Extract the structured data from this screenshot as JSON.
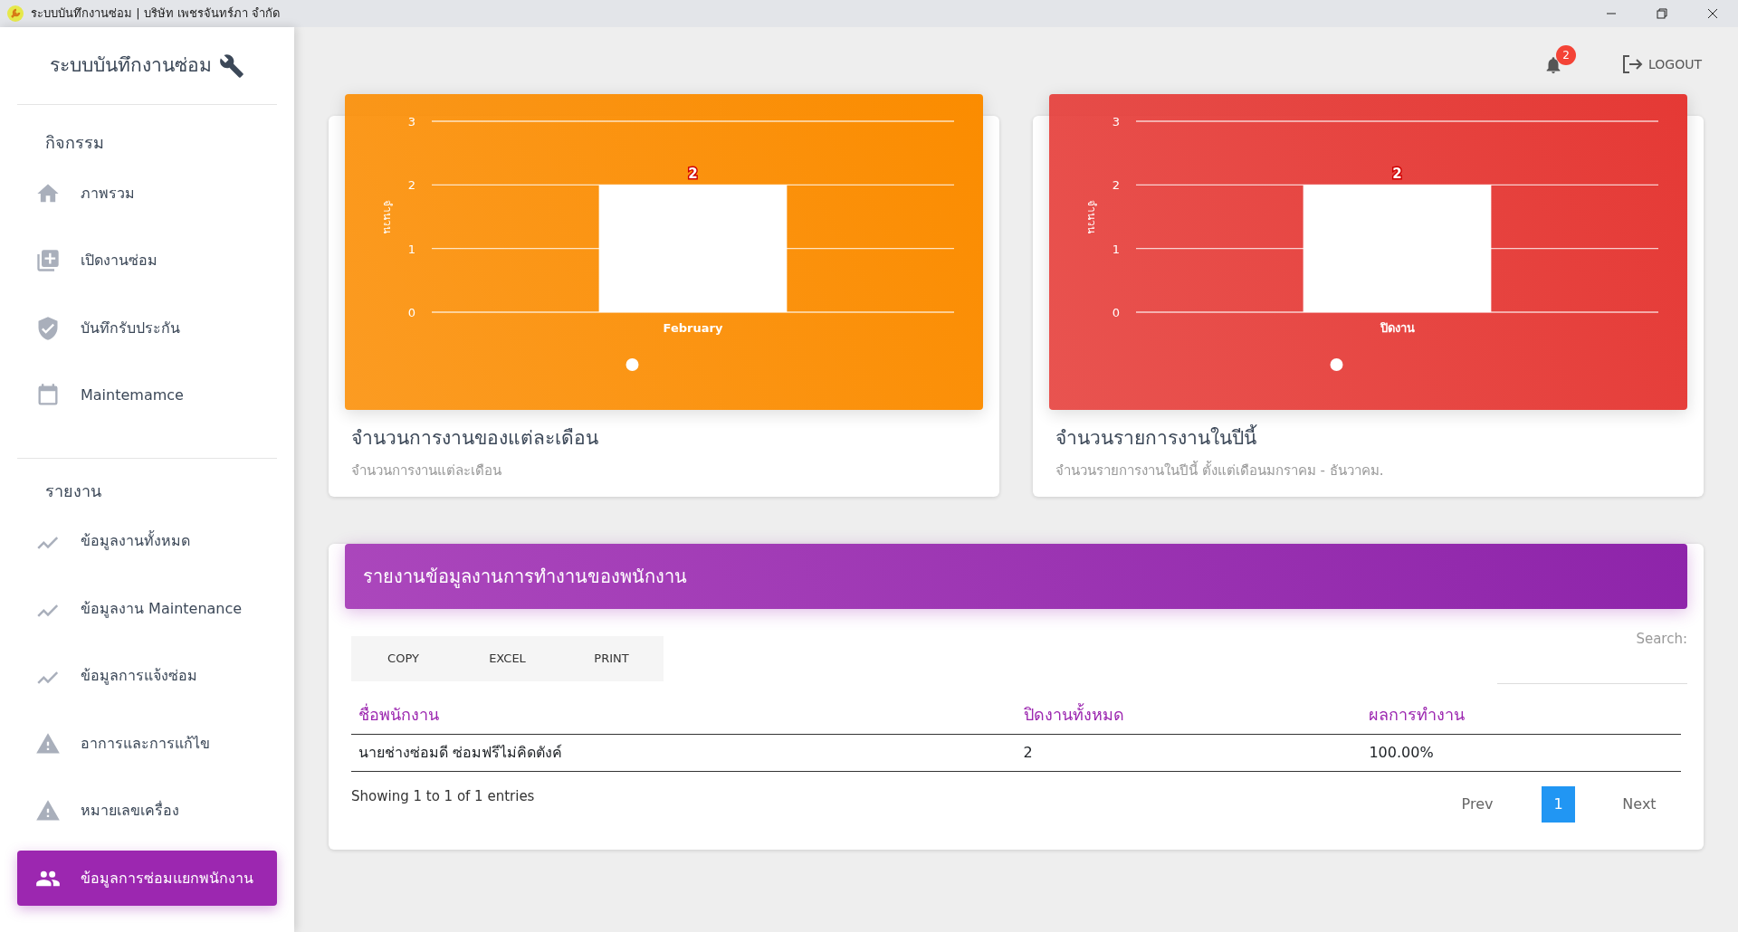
{
  "window": {
    "title": "ระบบบันทึกงานซ่อม | บริษัท เพชรจันทร์ภา จำกัด"
  },
  "sidebar": {
    "brand": "ระบบบันทึกงานซ่อม",
    "sections": [
      {
        "heading": "กิจกรรม",
        "items": [
          {
            "label": "ภาพรวม",
            "kind": "home",
            "selected": false
          },
          {
            "label": "เปิดงานซ่อม",
            "kind": "add",
            "selected": false
          },
          {
            "label": "บันทึกรับประกัน",
            "kind": "shield",
            "selected": false
          },
          {
            "label": "Maintemamce",
            "kind": "calendar",
            "selected": false
          }
        ]
      },
      {
        "heading": "รายงาน",
        "items": [
          {
            "label": "ข้อมูลงานทั้งหมด",
            "kind": "trend",
            "selected": false
          },
          {
            "label": "ข้อมูลงาน Maintenance",
            "kind": "trend",
            "selected": false
          },
          {
            "label": "ข้อมูลการแจ้งซ่อม",
            "kind": "trend",
            "selected": false
          },
          {
            "label": "อาการและการแก้ไข",
            "kind": "warning",
            "selected": false
          },
          {
            "label": "หมายเลขเครื่อง",
            "kind": "warning",
            "selected": false
          },
          {
            "label": "ข้อมูลการซ่อมแยกพนักงาน",
            "kind": "people",
            "selected": true
          }
        ]
      }
    ]
  },
  "topbar": {
    "notifications": "2",
    "logout": "LOGOUT"
  },
  "chart_cards": [
    {
      "color": "#fb8c00",
      "title": "จำนวนการงานของแต่ละเดือน",
      "subtitle": "จำนวนการงานแต่ละเดือน",
      "chart_data": {
        "type": "bar",
        "ylabel": "จำนวน",
        "categories": [
          "February"
        ],
        "values": [
          2
        ],
        "ylim": [
          0,
          3
        ],
        "yticks": [
          0,
          1,
          2,
          3
        ],
        "data_labels": true
      }
    },
    {
      "color": "#e53935",
      "title": "จำนวนรายการงานในปีนี้",
      "subtitle": "จำนวนรายการงานในปีนี้ ตั้งแต่เดือนมกราคม - ธันวาคม.",
      "chart_data": {
        "type": "bar",
        "ylabel": "จำนวน",
        "categories": [
          "ปิดงาน"
        ],
        "values": [
          2
        ],
        "ylim": [
          0,
          3
        ],
        "yticks": [
          0,
          1,
          2,
          3
        ],
        "data_labels": true
      }
    }
  ],
  "report": {
    "title": "รายงานข้อมูลงานการทำงานของพนักงาน",
    "buttons": [
      "COPY",
      "EXCEL",
      "PRINT"
    ],
    "search_label": "Search:",
    "columns": [
      "ชื่อพนักงาน",
      "ปิดงานทั้งหมด",
      "ผลการทำงาน"
    ],
    "rows": [
      [
        "นายช่างซ่อมดี ซ่อมฟรีไม่คิดตังค์",
        "2",
        "100.00%"
      ]
    ],
    "info": "Showing 1 to 1 of 1 entries",
    "pagination": [
      {
        "label": "Prev",
        "selected": false
      },
      {
        "label": "1",
        "selected": true
      },
      {
        "label": "Next",
        "selected": false
      }
    ]
  }
}
